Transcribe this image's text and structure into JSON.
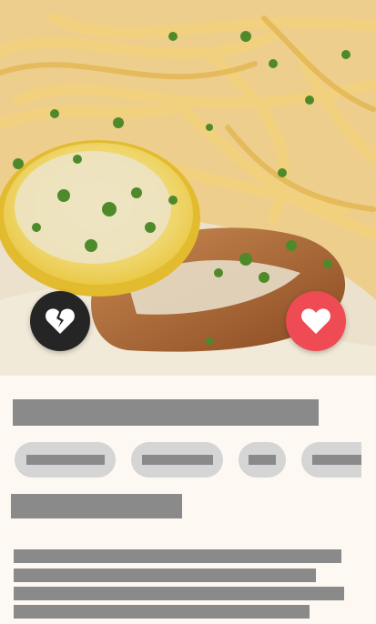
{
  "hero": {
    "image_description_icon": "pasta-dish-photo",
    "colors": {
      "plate": "#f3efe8",
      "sauce": "#e9ddc6",
      "pasta": "#f0c86a",
      "lemon": "#f2d34a",
      "herb": "#4f8a2a",
      "chicken": "#a45d2c"
    }
  },
  "actions": {
    "dislike_icon": "broken-heart-icon",
    "like_icon": "heart-icon",
    "colors": {
      "dislike_bg": "#252525",
      "like_bg": "#ef4b55"
    }
  },
  "placeholders": {
    "color": "#8a8a8a",
    "chip_color": "#d5d5d5"
  }
}
